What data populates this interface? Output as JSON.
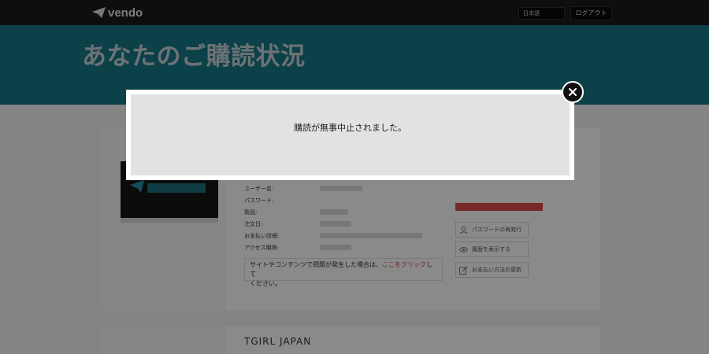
{
  "header": {
    "logo_text": "vendo",
    "language": "日本語",
    "logout_label": "ログアウト"
  },
  "hero": {
    "title": "あなたのご購読状況"
  },
  "subscription": {
    "fields": [
      {
        "label": "ユーザー名:"
      },
      {
        "label": "パスワード:"
      },
      {
        "label": "製品:"
      },
      {
        "label": "注文日:"
      },
      {
        "label": "お支払い詳細:"
      },
      {
        "label": "アクセス期限:"
      }
    ],
    "notice_text": "サイトやコンテンツで問題が発生した場合は、",
    "notice_link": "ここをクリック",
    "notice_suffix_1": "して",
    "notice_suffix_2": "ください。",
    "actions": [
      {
        "label": "パスワードの再発行",
        "icon": "user-icon"
      },
      {
        "label": "履歴を表示する",
        "icon": "eye-icon"
      },
      {
        "label": "お支払い方法の更新",
        "icon": "edit-icon"
      }
    ]
  },
  "second_card": {
    "title": "TGIRL JAPAN"
  },
  "modal": {
    "message": "購読が無事中止されました。"
  },
  "colors": {
    "hero_bg": "#17788a",
    "topbar_bg": "#1a1a1a",
    "accent_red": "#d94a4a",
    "modal_bg": "#e2e2e5"
  }
}
